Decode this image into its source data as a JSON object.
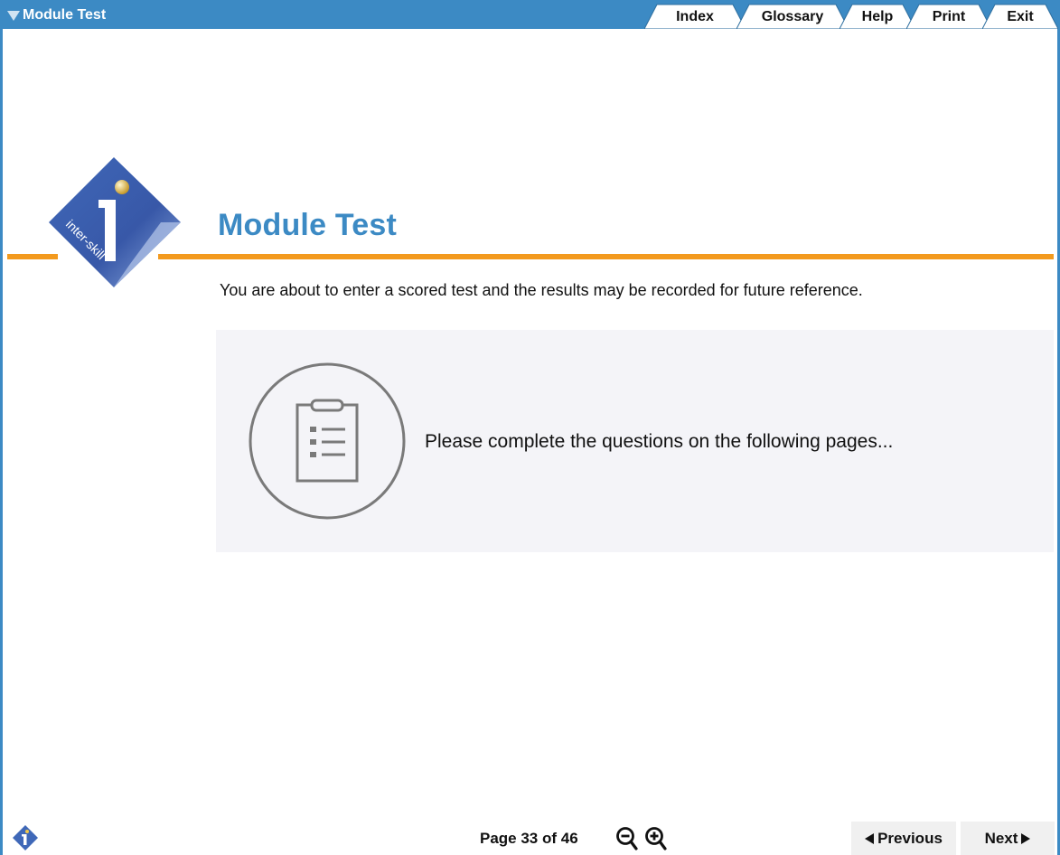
{
  "app": {
    "menu_title": "Module Test",
    "tabs": [
      "Index",
      "Glossary",
      "Help",
      "Print",
      "Exit"
    ]
  },
  "logo": {
    "text": "inter-skill"
  },
  "main": {
    "title": "Module Test",
    "intro": "You are about to enter a scored test and the results may be recorded for future reference.",
    "panel_text": "Please complete the questions on the following pages...",
    "panel_icon": "clipboard-list-icon"
  },
  "footer": {
    "page_indicator": "Page 33 of 46",
    "previous_label": "Previous",
    "next_label": "Next",
    "zoom_out_icon": "zoom-out-icon",
    "zoom_in_icon": "zoom-in-icon"
  },
  "colors": {
    "brand_blue": "#3c8ac4",
    "accent_orange": "#f39a1e",
    "panel_bg": "#f4f4f8"
  }
}
